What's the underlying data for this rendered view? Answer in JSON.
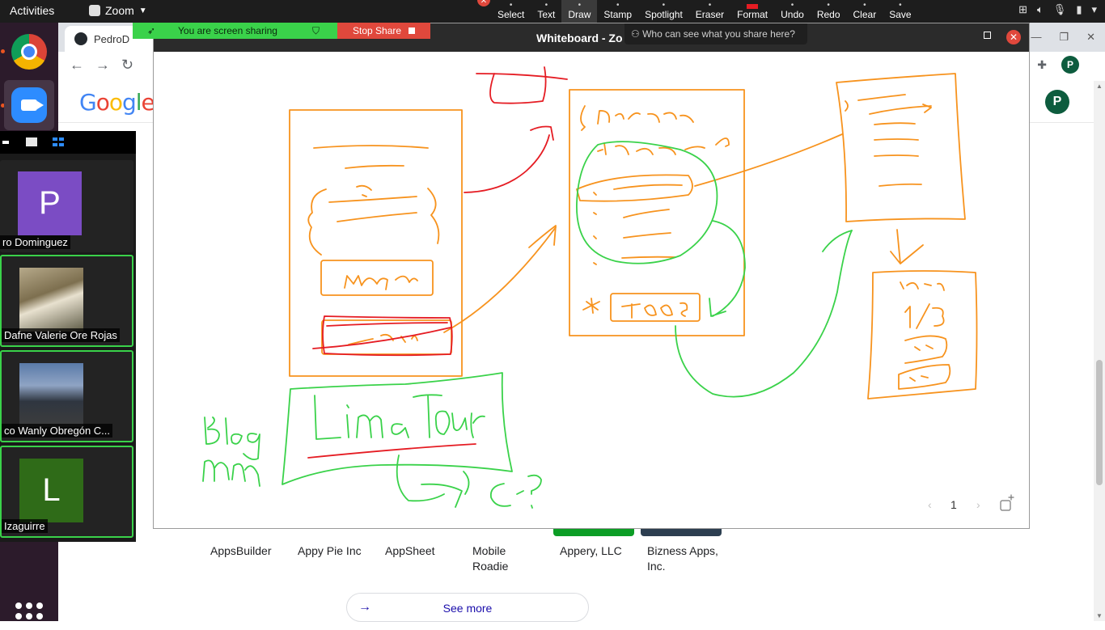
{
  "topbar": {
    "activities": "Activities",
    "app_name": "Zoom"
  },
  "wb_toolbar": {
    "tools": [
      {
        "label": "Select",
        "icon": "select-icon"
      },
      {
        "label": "Text",
        "icon": "text-icon"
      },
      {
        "label": "Draw",
        "icon": "draw-icon"
      },
      {
        "label": "Stamp",
        "icon": "stamp-icon"
      },
      {
        "label": "Spotlight",
        "icon": "spotlight-icon"
      },
      {
        "label": "Eraser",
        "icon": "eraser-icon"
      },
      {
        "label": "Format",
        "icon": "format-icon"
      },
      {
        "label": "Undo",
        "icon": "undo-icon"
      },
      {
        "label": "Redo",
        "icon": "redo-icon"
      },
      {
        "label": "Clear",
        "icon": "clear-icon"
      },
      {
        "label": "Save",
        "icon": "save-icon"
      }
    ],
    "active_tool": "Draw",
    "format_color": "#e51c23"
  },
  "share_banner": {
    "status": "You are screen sharing",
    "stop": "Stop Share"
  },
  "browser": {
    "tab_title": "PedroD"
  },
  "google": {
    "avatar": "P"
  },
  "whiteboard": {
    "title": "Whiteboard - Zo",
    "who_can_see": "Who can see what you share here?",
    "page_number": "1",
    "stroke_colors": {
      "orange": "#f7931e",
      "red": "#e51c23",
      "green": "#3ad24a"
    }
  },
  "gallery": {
    "participants": [
      {
        "name": "ro Dominguez",
        "avatar_letter": "P",
        "avatar_color": "#7b4cc4",
        "speaking": false
      },
      {
        "name": "Dafne Valerie Ore Rojas",
        "avatar_letter": "",
        "avatar_color": "",
        "speaking": true
      },
      {
        "name": "co Wanly Obregón C...",
        "avatar_letter": "",
        "avatar_color": "",
        "speaking": true
      },
      {
        "name": "Izaguirre",
        "avatar_letter": "L",
        "avatar_color": "#2f6b18",
        "speaking": true
      }
    ]
  },
  "results": {
    "appsheet_logo": "AppSheet",
    "vendors": [
      {
        "name": "AppsBuilder"
      },
      {
        "name": "Appy Pie Inc"
      },
      {
        "name": "AppSheet"
      },
      {
        "name": "Mobile Roadie"
      },
      {
        "name": "Appery, LLC",
        "tile_color": "#0c9d25"
      },
      {
        "name": "Bizness Apps, Inc.",
        "tile_color": "#2c3e50"
      }
    ],
    "see_more": "See more"
  }
}
